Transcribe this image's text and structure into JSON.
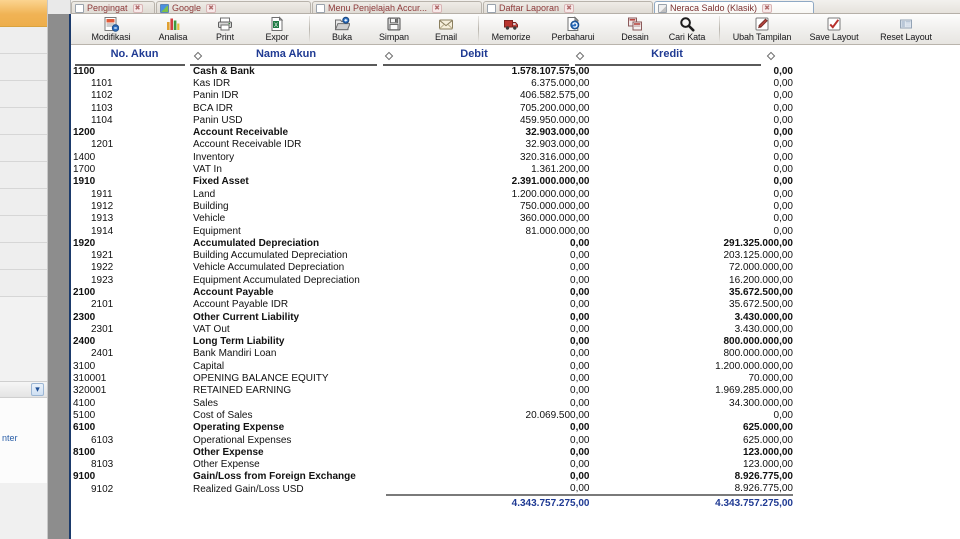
{
  "tabs": [
    {
      "label": "Pengingat",
      "icon": "window-icon",
      "active": false,
      "close": "✖"
    },
    {
      "label": "Google",
      "icon": "browser-icon",
      "active": false,
      "close": "✖"
    },
    {
      "label": "Menu Penjelajah Accur...",
      "icon": "window-icon",
      "active": false,
      "close": "✖"
    },
    {
      "label": "Daftar Laporan",
      "icon": "window-icon",
      "active": false,
      "close": "✖"
    },
    {
      "label": "Neraca Saldo (Klasik)",
      "icon": "report-icon",
      "active": true,
      "close": "✖"
    }
  ],
  "toolbar": {
    "groups": [
      {
        "buttons": [
          {
            "label": "Modifikasi",
            "icon": "modify-report-icon"
          },
          {
            "label": "Analisa",
            "icon": "bar-chart-icon"
          },
          {
            "label": "Print",
            "icon": "printer-icon"
          },
          {
            "label": "Expor",
            "icon": "excel-export-icon"
          }
        ]
      },
      {
        "buttons": [
          {
            "label": "Buka",
            "icon": "open-folder-icon"
          },
          {
            "label": "Simpan",
            "icon": "floppy-save-icon"
          },
          {
            "label": "Email",
            "icon": "envelope-icon"
          }
        ]
      },
      {
        "buttons": [
          {
            "label": "Memorize",
            "icon": "memorize-truck-icon"
          },
          {
            "label": "Perbaharui",
            "icon": "refresh-page-icon"
          },
          {
            "label": "Desain",
            "icon": "design-layout-icon"
          },
          {
            "label": "Cari Kata",
            "icon": "magnifier-icon"
          }
        ]
      },
      {
        "buttons": [
          {
            "label": "Ubah Tampilan",
            "icon": "edit-pencil-icon"
          },
          {
            "label": "Save Layout",
            "icon": "check-layout-icon",
            "accel": "L"
          },
          {
            "label": "Reset Layout",
            "icon": "reset-layout-icon",
            "accel": "R"
          }
        ]
      }
    ]
  },
  "sidebar": {
    "footer_text": "nter",
    "expand_icon": "chevron-double-down-icon"
  },
  "report": {
    "headers": [
      "No. Akun",
      "Nama Akun",
      "Debit",
      "Kredit"
    ],
    "sort_icon": "sort-diamond-icon",
    "accent_color": "#1f3a93",
    "rows": [
      {
        "code": "1100",
        "name": "Cash & Bank",
        "debit": "1.578.107.575,00",
        "credit": "0,00",
        "parent": true
      },
      {
        "code": "1101",
        "name": "Kas IDR",
        "debit": "6.375.000,00",
        "credit": "0,00",
        "parent": false
      },
      {
        "code": "1102",
        "name": "Panin IDR",
        "debit": "406.582.575,00",
        "credit": "0,00",
        "parent": false
      },
      {
        "code": "1103",
        "name": "BCA IDR",
        "debit": "705.200.000,00",
        "credit": "0,00",
        "parent": false
      },
      {
        "code": "1104",
        "name": "Panin USD",
        "debit": "459.950.000,00",
        "credit": "0,00",
        "parent": false
      },
      {
        "code": "1200",
        "name": "Account Receivable",
        "debit": "32.903.000,00",
        "credit": "0,00",
        "parent": true
      },
      {
        "code": "1201",
        "name": "Account Receivable IDR",
        "debit": "32.903.000,00",
        "credit": "0,00",
        "parent": false
      },
      {
        "code": "1400",
        "name": "Inventory",
        "debit": "320.316.000,00",
        "credit": "0,00",
        "parent": false,
        "top": true
      },
      {
        "code": "1700",
        "name": "VAT In",
        "debit": "1.361.200,00",
        "credit": "0,00",
        "parent": false,
        "top": true
      },
      {
        "code": "1910",
        "name": "Fixed Asset",
        "debit": "2.391.000.000,00",
        "credit": "0,00",
        "parent": true
      },
      {
        "code": "1911",
        "name": "Land",
        "debit": "1.200.000.000,00",
        "credit": "0,00",
        "parent": false
      },
      {
        "code": "1912",
        "name": "Building",
        "debit": "750.000.000,00",
        "credit": "0,00",
        "parent": false
      },
      {
        "code": "1913",
        "name": "Vehicle",
        "debit": "360.000.000,00",
        "credit": "0,00",
        "parent": false
      },
      {
        "code": "1914",
        "name": "Equipment",
        "debit": "81.000.000,00",
        "credit": "0,00",
        "parent": false
      },
      {
        "code": "1920",
        "name": "Accumulated Depreciation",
        "debit": "0,00",
        "credit": "291.325.000,00",
        "parent": true
      },
      {
        "code": "1921",
        "name": "Building Accumulated Depreciation",
        "debit": "0,00",
        "credit": "203.125.000,00",
        "parent": false
      },
      {
        "code": "1922",
        "name": "Vehicle Accumulated Depreciation",
        "debit": "0,00",
        "credit": "72.000.000,00",
        "parent": false
      },
      {
        "code": "1923",
        "name": "Equipment Accumulated Depreciation",
        "debit": "0,00",
        "credit": "16.200.000,00",
        "parent": false
      },
      {
        "code": "2100",
        "name": "Account Payable",
        "debit": "0,00",
        "credit": "35.672.500,00",
        "parent": true
      },
      {
        "code": "2101",
        "name": "Account Payable IDR",
        "debit": "0,00",
        "credit": "35.672.500,00",
        "parent": false
      },
      {
        "code": "2300",
        "name": "Other Current Liability",
        "debit": "0,00",
        "credit": "3.430.000,00",
        "parent": true
      },
      {
        "code": "2301",
        "name": "VAT Out",
        "debit": "0,00",
        "credit": "3.430.000,00",
        "parent": false
      },
      {
        "code": "2400",
        "name": "Long Term Liability",
        "debit": "0,00",
        "credit": "800.000.000,00",
        "parent": true
      },
      {
        "code": "2401",
        "name": "Bank Mandiri Loan",
        "debit": "0,00",
        "credit": "800.000.000,00",
        "parent": false
      },
      {
        "code": "3100",
        "name": "Capital",
        "debit": "0,00",
        "credit": "1.200.000.000,00",
        "parent": false,
        "top": true
      },
      {
        "code": "310001",
        "name": "OPENING BALANCE EQUITY",
        "debit": "0,00",
        "credit": "70.000,00",
        "parent": false,
        "top": true
      },
      {
        "code": "320001",
        "name": "RETAINED EARNING",
        "debit": "0,00",
        "credit": "1.969.285.000,00",
        "parent": false,
        "top": true
      },
      {
        "code": "4100",
        "name": "Sales",
        "debit": "0,00",
        "credit": "34.300.000,00",
        "parent": false,
        "top": true
      },
      {
        "code": "5100",
        "name": "Cost of Sales",
        "debit": "20.069.500,00",
        "credit": "0,00",
        "parent": false,
        "top": true
      },
      {
        "code": "6100",
        "name": "Operating Expense",
        "debit": "0,00",
        "credit": "625.000,00",
        "parent": true
      },
      {
        "code": "6103",
        "name": "Operational Expenses",
        "debit": "0,00",
        "credit": "625.000,00",
        "parent": false
      },
      {
        "code": "8100",
        "name": "Other Expense",
        "debit": "0,00",
        "credit": "123.000,00",
        "parent": true
      },
      {
        "code": "8103",
        "name": "Other Expense",
        "debit": "0,00",
        "credit": "123.000,00",
        "parent": false
      },
      {
        "code": "9100",
        "name": "Gain/Loss from Foreign Exchange",
        "debit": "0,00",
        "credit": "8.926.775,00",
        "parent": true
      },
      {
        "code": "9102",
        "name": "Realized Gain/Loss USD",
        "debit": "0,00",
        "credit": "8.926.775,00",
        "parent": false
      }
    ],
    "total": {
      "code": "",
      "name": "",
      "debit": "4.343.757.275,00",
      "credit": "4.343.757.275,00"
    }
  }
}
